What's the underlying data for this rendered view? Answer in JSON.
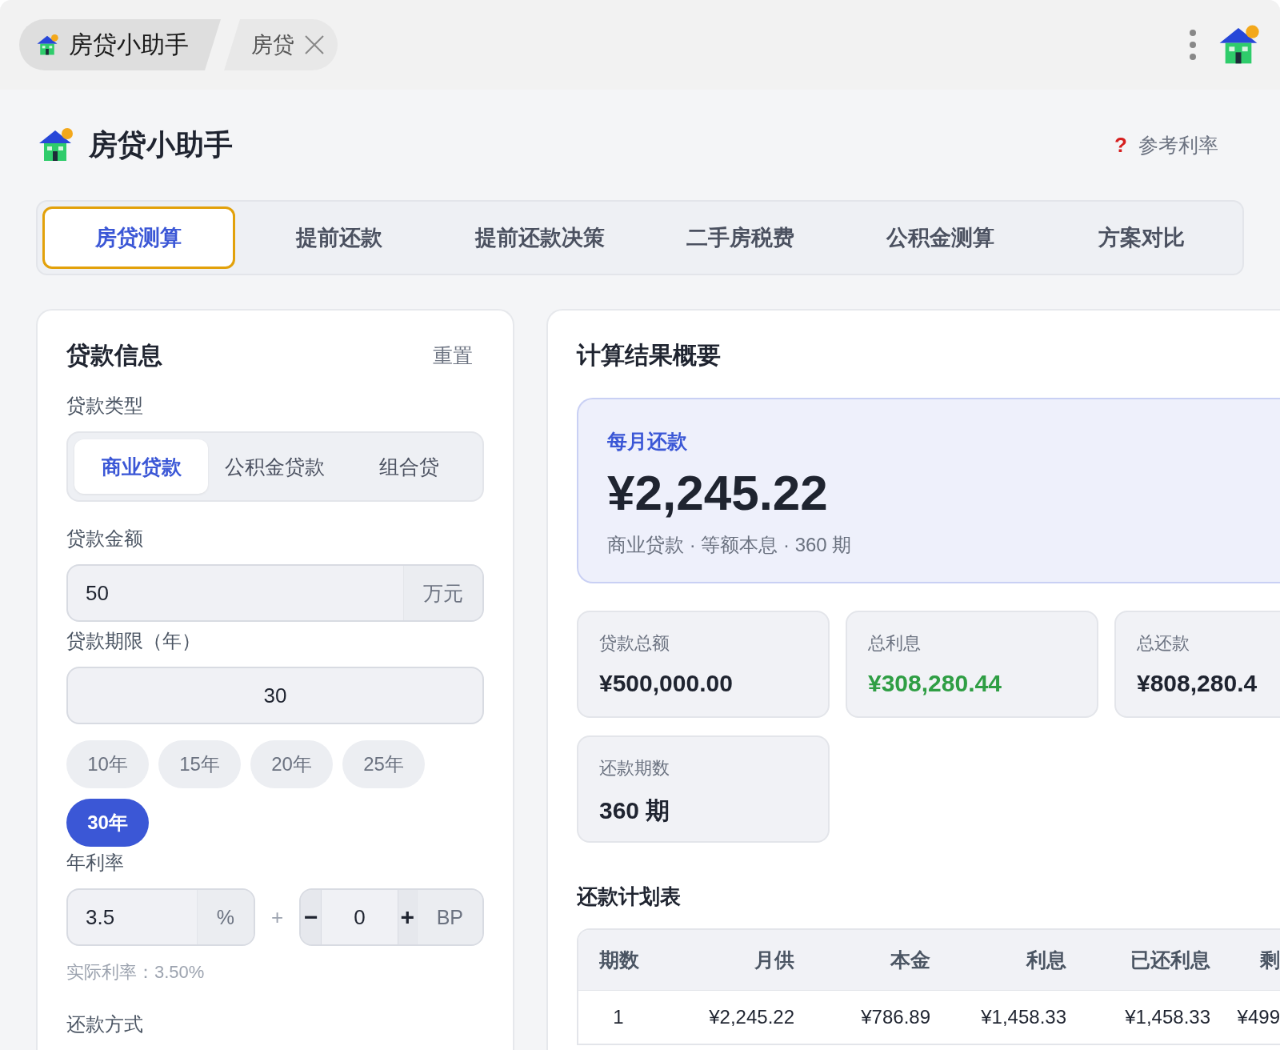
{
  "titlebar": {
    "tabs": [
      {
        "label": "房贷小助手",
        "selected": true
      },
      {
        "label": "房贷",
        "selected": false
      }
    ]
  },
  "header": {
    "title": "房贷小助手",
    "help_mark": "?",
    "help_link": "参考利率"
  },
  "tabs": [
    {
      "label": "房贷测算",
      "selected": true
    },
    {
      "label": "提前还款",
      "selected": false
    },
    {
      "label": "提前还款决策",
      "selected": false
    },
    {
      "label": "二手房税费",
      "selected": false
    },
    {
      "label": "公积金测算",
      "selected": false
    },
    {
      "label": "方案对比",
      "selected": false
    }
  ],
  "loan_form": {
    "title": "贷款信息",
    "reset": "重置",
    "type_label": "贷款类型",
    "loan_types": [
      {
        "label": "商业贷款",
        "selected": true
      },
      {
        "label": "公积金贷款",
        "selected": false
      },
      {
        "label": "组合贷",
        "selected": false
      }
    ],
    "amount_label": "贷款金额",
    "amount_value": "50",
    "amount_unit": "万元",
    "term_label": "贷款期限（年）",
    "term_value": "30",
    "term_presets": [
      {
        "label": "10年",
        "selected": false
      },
      {
        "label": "15年",
        "selected": false
      },
      {
        "label": "20年",
        "selected": false
      },
      {
        "label": "25年",
        "selected": false
      },
      {
        "label": "30年",
        "selected": true
      }
    ],
    "rate_label": "年利率",
    "rate_value": "3.5",
    "rate_unit": "%",
    "plus": "+",
    "minus_button": "−",
    "bp_value": "0",
    "plus_button": "+",
    "bp_unit": "BP",
    "effective_rate": "实际利率：3.50%",
    "method_label": "还款方式"
  },
  "summary": {
    "title": "计算结果概要",
    "hero_label": "每月还款",
    "hero_amount": "¥2,245.22",
    "hero_note": "商业贷款 · 等额本息 · 360 期",
    "stats": [
      {
        "label": "贷款总额",
        "value": "¥500,000.00",
        "kind": "plain"
      },
      {
        "label": "总利息",
        "value": "¥308,280.44",
        "kind": "accent"
      },
      {
        "label": "总还款",
        "value": "¥808,280.4",
        "kind": "plain"
      },
      {
        "label": "还款期数",
        "value": "360 期",
        "kind": "plain"
      }
    ]
  },
  "schedule": {
    "title": "还款计划表",
    "columns": [
      "期数",
      "月供",
      "本金",
      "利息",
      "已还利息",
      "剩"
    ],
    "rows": [
      [
        "1",
        "¥2,245.22",
        "¥786.89",
        "¥1,458.33",
        "¥1,458.33",
        "¥499"
      ]
    ]
  }
}
